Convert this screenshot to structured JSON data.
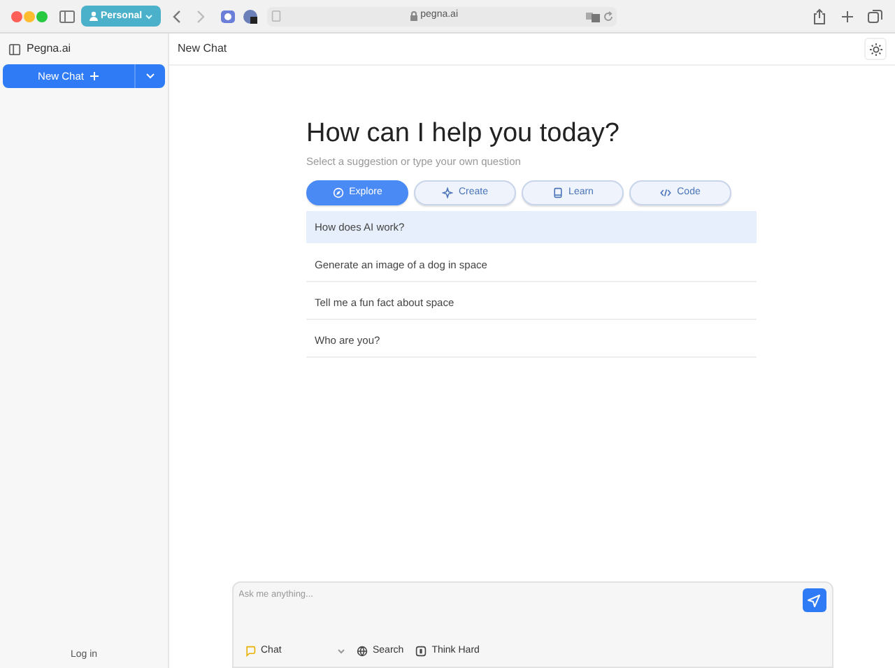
{
  "browser": {
    "profile": "Personal",
    "address": "pegna.ai"
  },
  "sidebar": {
    "title": "Pegna.ai",
    "new_chat": "New Chat",
    "login": "Log in"
  },
  "header": {
    "title": "New Chat"
  },
  "heading": "How can I help you today?",
  "subtitle": "Select a suggestion or type your own question",
  "modes": [
    {
      "label": "Explore",
      "kind": "compass",
      "selected": true
    },
    {
      "label": "Create",
      "kind": "sparkle",
      "selected": false
    },
    {
      "label": "Learn",
      "kind": "book",
      "selected": false
    },
    {
      "label": "Code",
      "kind": "code",
      "selected": false
    }
  ],
  "suggestions": [
    {
      "text": "How does AI work?",
      "selected": true
    },
    {
      "text": "Generate an image of a dog in space",
      "selected": false
    },
    {
      "text": "Tell me a fun fact about space",
      "selected": false
    },
    {
      "text": "Who are you?",
      "selected": false
    }
  ],
  "composer": {
    "placeholder": "Ask me anything...",
    "tools": [
      {
        "label": "Chat",
        "kind": "chat"
      },
      {
        "label": "Search",
        "kind": "globe"
      },
      {
        "label": "Think Hard",
        "kind": "think"
      }
    ]
  }
}
